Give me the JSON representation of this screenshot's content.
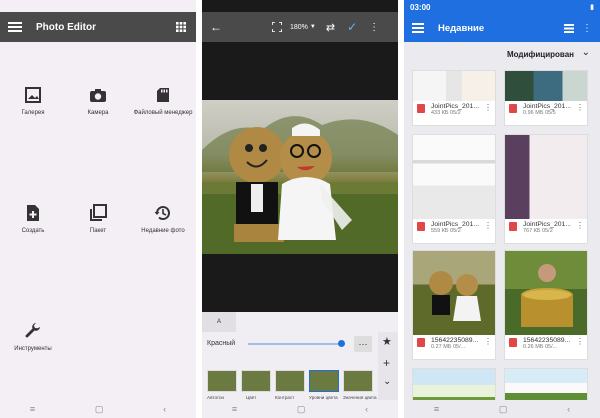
{
  "panel1": {
    "app_title": "Photo Editor",
    "items": [
      {
        "label": "Галерея",
        "icon": "gallery-icon"
      },
      {
        "label": "Камера",
        "icon": "camera-icon"
      },
      {
        "label": "Файловый менеджер",
        "icon": "sd-card-icon"
      },
      {
        "label": "Создать",
        "icon": "new-file-icon"
      },
      {
        "label": "Пакет",
        "icon": "batch-icon"
      },
      {
        "label": "Недавние фото",
        "icon": "history-icon"
      },
      {
        "label": "Инструменты",
        "icon": "wrench-icon"
      }
    ]
  },
  "panel2": {
    "zoom": "180%",
    "tab_label": "A",
    "channel": "Красный",
    "filters": [
      {
        "label": "Автотон"
      },
      {
        "label": "Цвет"
      },
      {
        "label": "Контраст"
      },
      {
        "label": "Уровни цвета"
      },
      {
        "label": "Значения цвета"
      }
    ]
  },
  "panel3": {
    "status_time": "03:00",
    "title": "Недавние",
    "sort_label": "Модифицирован",
    "files": [
      {
        "name": "JointPics_201...",
        "size": "433 КБ 05/2"
      },
      {
        "name": "JointPics_201...",
        "size": "0.96 МБ 05/5"
      },
      {
        "name": "JointPics_201...",
        "size": "559 КБ 05/2"
      },
      {
        "name": "JointPics_201...",
        "size": "767 КБ 05/2"
      },
      {
        "name": "15642235089...",
        "size": "0.27 МБ 05/..."
      },
      {
        "name": "15642235089...",
        "size": "0.26 МБ 05/..."
      }
    ]
  }
}
